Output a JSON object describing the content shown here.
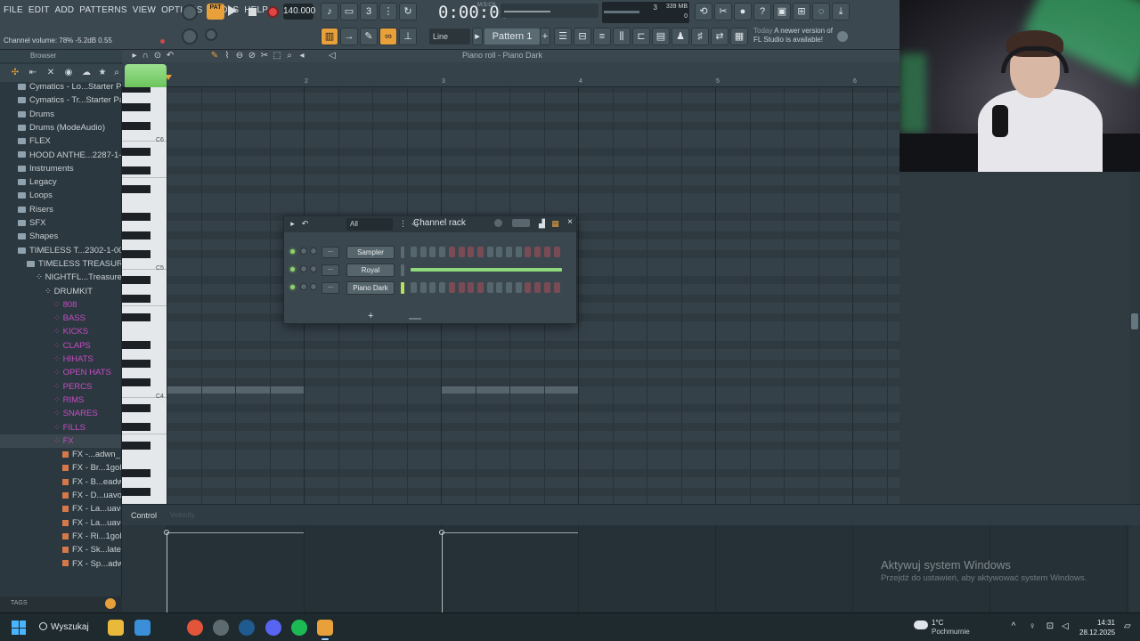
{
  "menu": [
    "FILE",
    "EDIT",
    "ADD",
    "PATTERNS",
    "VIEW",
    "OPTIONS",
    "TOOLS",
    "HELP"
  ],
  "hint": "Channel volume: 78%  -5.2dB  0.55",
  "transport": {
    "pat_label": "PAT",
    "tempo": "140.000",
    "time": "0:00:00",
    "time_unit": "M:S:CS"
  },
  "monitor": {
    "memory": "339 MB",
    "cpu": "3",
    "poly": "0"
  },
  "toolbar2": {
    "snap": "Line",
    "pattern": "Pattern 1"
  },
  "news": {
    "line1_muted": "Today",
    "line1": "A newer version of",
    "line2": "FL Studio is available!"
  },
  "browser": {
    "title": "Browser",
    "items": [
      {
        "label": "Cymatics - Lo...Starter Pack",
        "type": "folder",
        "indent": 1
      },
      {
        "label": "Cymatics - Tr...Starter Pack",
        "type": "folder",
        "indent": 1
      },
      {
        "label": "Drums",
        "type": "folder",
        "indent": 1
      },
      {
        "label": "Drums (ModeAudio)",
        "type": "folder",
        "indent": 1
      },
      {
        "label": "FLEX",
        "type": "folder",
        "indent": 1
      },
      {
        "label": "HOOD ANTHE...2287-1-001",
        "type": "folder",
        "indent": 1
      },
      {
        "label": "Instruments",
        "type": "folder",
        "indent": 1
      },
      {
        "label": "Legacy",
        "type": "folder",
        "indent": 1
      },
      {
        "label": "Loops",
        "type": "folder",
        "indent": 1
      },
      {
        "label": "Risers",
        "type": "folder",
        "indent": 1
      },
      {
        "label": "SFX",
        "type": "folder",
        "indent": 1
      },
      {
        "label": "Shapes",
        "type": "folder",
        "indent": 1
      },
      {
        "label": "TIMELESS T...2302-1-001",
        "type": "folder",
        "indent": 1
      },
      {
        "label": "TIMELESS TREASURES",
        "type": "folder",
        "indent": 2
      },
      {
        "label": "NIGHTFL...Treasures",
        "type": "open",
        "indent": 3
      },
      {
        "label": "DRUMKIT",
        "type": "open",
        "indent": 4
      },
      {
        "label": "808",
        "type": "pink",
        "indent": 5
      },
      {
        "label": "BASS",
        "type": "pink",
        "indent": 5
      },
      {
        "label": "KICKS",
        "type": "pink",
        "indent": 5
      },
      {
        "label": "CLAPS",
        "type": "pink",
        "indent": 5
      },
      {
        "label": "HIHATS",
        "type": "pink",
        "indent": 5
      },
      {
        "label": "OPEN HATS",
        "type": "pink",
        "indent": 5
      },
      {
        "label": "PERCS",
        "type": "pink",
        "indent": 5
      },
      {
        "label": "RIMS",
        "type": "pink",
        "indent": 5
      },
      {
        "label": "SNARES",
        "type": "pink",
        "indent": 5
      },
      {
        "label": "FILLS",
        "type": "pink",
        "indent": 5
      },
      {
        "label": "FX",
        "type": "pink",
        "indent": 5
      },
      {
        "label": "FX -...adwn_",
        "type": "fx",
        "indent": 6
      },
      {
        "label": "FX - Br...1golfie",
        "type": "fx",
        "indent": 6
      },
      {
        "label": "FX - B...eadwn_",
        "type": "fx",
        "indent": 6
      },
      {
        "label": "FX - D...uavonf",
        "type": "fx",
        "indent": 6
      },
      {
        "label": "FX - La...uavonf",
        "type": "fx",
        "indent": 6
      },
      {
        "label": "FX - La...uavonf",
        "type": "fx",
        "indent": 6
      },
      {
        "label": "FX - Ri...1golfie",
        "type": "fx",
        "indent": 6
      },
      {
        "label": "FX - Sk...latefor",
        "type": "fx",
        "indent": 6
      },
      {
        "label": "FX - Sp...adwn_",
        "type": "fx",
        "indent": 6
      }
    ],
    "tags_label": "TAGS"
  },
  "pianoroll": {
    "title": "Piano roll - Piano Dark",
    "bars": [
      "2",
      "3",
      "4",
      "5",
      "6"
    ],
    "key_labels": [
      "C6",
      "C5",
      "C4"
    ],
    "control_label": "Control",
    "control_sub": "Velocity"
  },
  "channel_rack": {
    "filter": "All",
    "title": "Channel rack",
    "channels": [
      {
        "name": "Sampler",
        "mode": "steps",
        "selected": false
      },
      {
        "name": "Royal",
        "mode": "roll",
        "selected": false
      },
      {
        "name": "Piano Dark",
        "mode": "steps",
        "selected": true
      }
    ],
    "add_label": "+"
  },
  "watermark": {
    "line1": "Aktywuj system Windows",
    "line2": "Przejdź do ustawień, aby aktywować system Windows."
  },
  "taskbar": {
    "search": "Wyszukaj",
    "weather_temp": "1°C",
    "weather_desc": "Pochmurnie",
    "weather_badge": "3",
    "time": "14:31",
    "date": "28.12.2025"
  }
}
